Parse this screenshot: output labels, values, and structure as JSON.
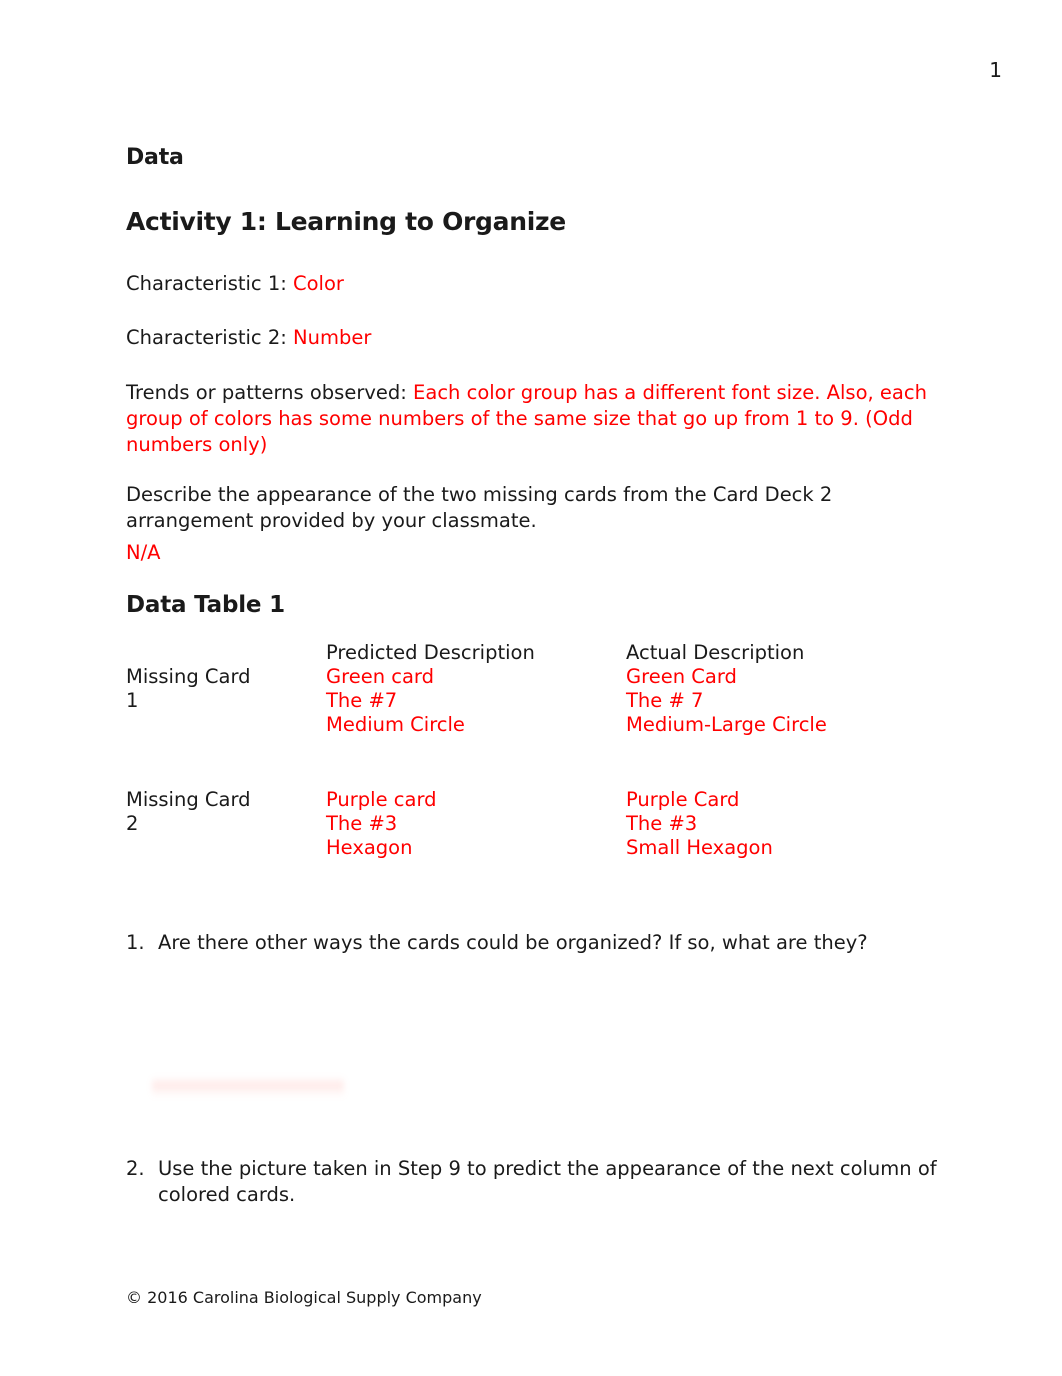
{
  "document": {
    "page_number": "1",
    "heading": "Data",
    "activity_heading": "Activity 1: Learning to Organize",
    "footer": "© 2016 Carolina Biological Supply Company",
    "answer_color": "#ff0000",
    "text_color": "#1a1a1a"
  },
  "prompts": {
    "characteristic_1_label": "Characteristic 1: ",
    "characteristic_1_answer": "Color",
    "characteristic_2_label": "Characteristic 2: ",
    "characteristic_2_answer": "Number",
    "trends_label": "Trends or patterns observed: ",
    "trends_answer": "Each color group has a different font size. Also, each group of colors has some numbers of the same size that go up from 1 to 9. (Odd numbers only)",
    "describe_prompt": "Describe the appearance of the two missing cards from the Card Deck 2 arrangement provided by your classmate.",
    "describe_answer": "N/A"
  },
  "data_table": {
    "title": "Data Table 1",
    "headers": {
      "row_label": "",
      "predicted": "Predicted Description",
      "actual": "Actual Description"
    },
    "rows": [
      {
        "label_line_1": "Missing Card",
        "label_line_2": "1",
        "predicted": [
          "Green card",
          "The #7",
          "Medium Circle"
        ],
        "actual": [
          "Green Card",
          "The # 7",
          "Medium-Large Circle"
        ]
      },
      {
        "label_line_1": "Missing Card",
        "label_line_2": "2",
        "predicted": [
          "Purple card",
          "The #3",
          "Hexagon"
        ],
        "actual": [
          "Purple Card",
          "The #3",
          "Small Hexagon"
        ]
      }
    ]
  },
  "questions": [
    {
      "number": "1.",
      "text": "Are there other ways the cards could be organized? If so, what are they?",
      "answer": ""
    },
    {
      "number": "2.",
      "text": "Use the picture taken in Step 9 to predict the appearance of the next column of colored cards.",
      "answer": ""
    }
  ]
}
